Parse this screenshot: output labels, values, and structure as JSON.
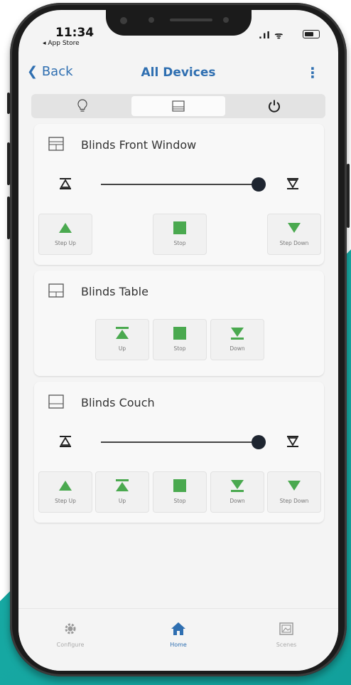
{
  "status_bar": {
    "time": "11:34",
    "back_app": "◂ App Store",
    "signal": ".ıl ᯤ"
  },
  "nav": {
    "back_label": "Back",
    "title": "All Devices",
    "more": "⋮"
  },
  "tabs": [
    {
      "name": "lights",
      "icon": "bulb-icon",
      "active": false
    },
    {
      "name": "blinds",
      "icon": "blinds-icon",
      "active": true
    },
    {
      "name": "power",
      "icon": "power-icon",
      "active": false
    }
  ],
  "devices": [
    {
      "title": "Blinds Front Window",
      "slider_level": 1.0,
      "controls": [
        "Step Up",
        "Stop",
        "Step Down"
      ]
    },
    {
      "title": "Blinds Table",
      "controls": [
        "Up",
        "Stop",
        "Down"
      ]
    },
    {
      "title": "Blinds Couch",
      "slider_level": 1.0,
      "controls": [
        "Step Up",
        "Up",
        "Stop",
        "Down",
        "Step Down"
      ]
    }
  ],
  "bottom_nav": [
    {
      "label": "Configure",
      "icon": "gear-icon"
    },
    {
      "label": "Home",
      "icon": "home-icon",
      "active": true
    },
    {
      "label": "Scenes",
      "icon": "scenes-icon"
    }
  ],
  "colors": {
    "accent": "#2f6fb1",
    "control_green": "#4aa94f",
    "brand_teal": "#17a9a3"
  }
}
